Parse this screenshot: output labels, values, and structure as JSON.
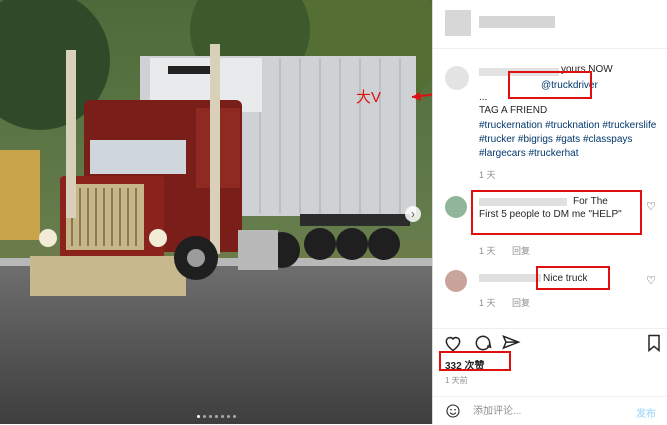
{
  "post": {
    "caption": {
      "lead_text": "yours NOW",
      "mention": "@truckdriver",
      "ellipsis": "...",
      "tag_friend": "TAG A FRIEND",
      "hashtags": "#truckernation #trucknation #truckerslife #trucker #bigrigs #gats #classpays #largecars #truckerhat",
      "time": "1 天"
    },
    "annotation_label": "大V",
    "comments": [
      {
        "text_head": "For The",
        "text_body": "First 5 people to DM me \"HELP\"",
        "time": "1 天",
        "reply": "回复"
      },
      {
        "text": "Nice truck",
        "time": "1 天",
        "reply": "回复"
      }
    ],
    "likes": "332 次赞",
    "posted_time": "1 天前"
  },
  "comment_box": {
    "placeholder": "添加评论...",
    "post_label": "发布"
  },
  "colors": {
    "annotation": "#e01010",
    "hashtag": "#00376b",
    "post_button": "#b2dffc"
  },
  "icons": [
    "emoji-icon",
    "heart-icon",
    "comment-icon",
    "share-icon",
    "bookmark-icon",
    "next-arrow-icon"
  ],
  "carousel": {
    "slides": 7,
    "active": 1
  }
}
